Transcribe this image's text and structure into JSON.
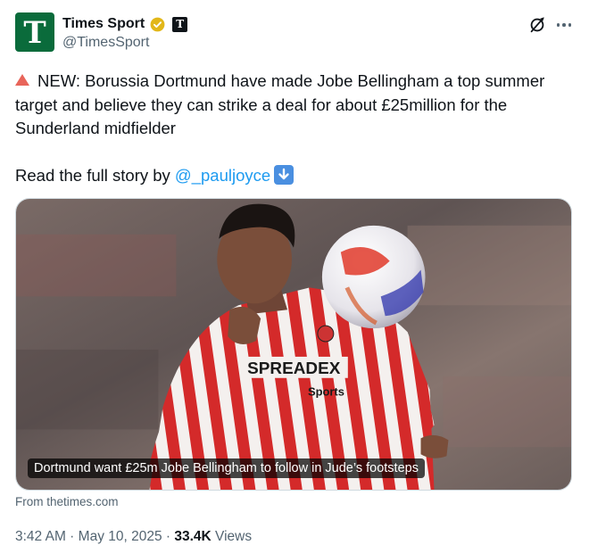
{
  "account": {
    "avatar_letter": "T",
    "display_name": "Times Sport",
    "affiliate_badge": "T",
    "handle": "@TimesSport",
    "brand_color": "#0a6b3b"
  },
  "tweet": {
    "line1_icon": "red-triangle-up-icon",
    "text": "NEW: Borussia Dortmund have made Jobe Bellingham a top summer target and believe they can strike a deal for about £25million for the Sunderland midfielder",
    "read_prefix": "Read the full story by ",
    "mention": "@_pauljoyce",
    "read_suffix_icon": "down-arrow-emoji-icon"
  },
  "card": {
    "caption": "Dortmund want £25m Jobe Bellingham to follow in Jude’s footsteps",
    "source": "From thetimes.com",
    "shirt_sponsor": "SPREADEX",
    "shirt_sponsor_sub": "Sports"
  },
  "meta": {
    "time": "3:42 AM",
    "sep1": " · ",
    "date": "May 10, 2025",
    "sep2": " · ",
    "views_count": "33.4K",
    "views_label": " Views"
  },
  "colors": {
    "text": "#0f1419",
    "secondary": "#536471",
    "link": "#1d9bf0"
  }
}
